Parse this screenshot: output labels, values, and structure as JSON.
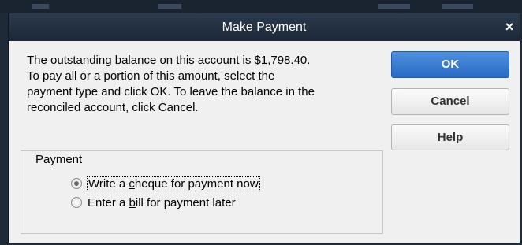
{
  "dialog": {
    "title": "Make Payment",
    "close_glyph": "×",
    "message_lines": [
      "The outstanding balance on this account is $1,798.40.",
      "To pay all or a portion of this amount,  select the",
      "payment type and click OK.  To leave the balance in the",
      "reconciled account, click Cancel."
    ]
  },
  "buttons": {
    "ok": "OK",
    "cancel": "Cancel",
    "help": "Help"
  },
  "payment": {
    "label": "Payment",
    "options": [
      {
        "pre": "Write a ",
        "key": "c",
        "post": "heque for payment now",
        "selected": true
      },
      {
        "pre": "Enter a ",
        "key": "b",
        "post": "ill for payment later",
        "selected": false
      }
    ]
  },
  "colors": {
    "titlebar": "#1c2837",
    "ok_button": "#2a6bc4",
    "dialog_bg": "#f0f0f0"
  },
  "icons": {
    "close": "close-icon",
    "radio": "radio-button-icon"
  }
}
